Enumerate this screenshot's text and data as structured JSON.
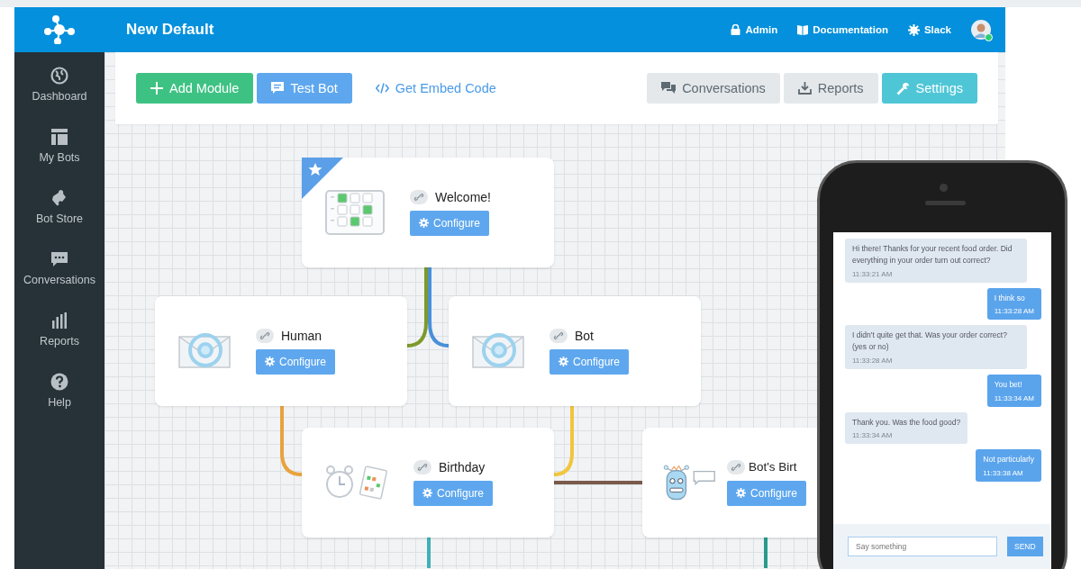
{
  "header": {
    "title": "New Default",
    "links": [
      {
        "label": "Admin"
      },
      {
        "label": "Documentation"
      },
      {
        "label": "Slack"
      }
    ],
    "user": {
      "online": true
    }
  },
  "sidebar": {
    "items": [
      {
        "label": "Dashboard"
      },
      {
        "label": "My Bots"
      },
      {
        "label": "Bot Store"
      },
      {
        "label": "Conversations"
      },
      {
        "label": "Reports"
      },
      {
        "label": "Help"
      }
    ]
  },
  "toolbar": {
    "left": [
      {
        "label": "Add Module"
      },
      {
        "label": "Test Bot"
      },
      {
        "label": "Get Embed Code"
      }
    ],
    "right": [
      {
        "label": "Conversations"
      },
      {
        "label": "Reports"
      },
      {
        "label": "Settings"
      }
    ]
  },
  "modules": [
    {
      "title": "Welcome!",
      "kind": "checklist",
      "starred": true,
      "button": "Configure"
    },
    {
      "title": "Human",
      "kind": "email",
      "starred": false,
      "button": "Configure"
    },
    {
      "title": "Bot",
      "kind": "email",
      "starred": false,
      "button": "Configure"
    },
    {
      "title": "Birthday",
      "kind": "schedule",
      "starred": false,
      "button": "Configure"
    },
    {
      "title": "Bot's Birt",
      "kind": "robot",
      "starred": false,
      "button": "Configure"
    }
  ],
  "connectors": [
    {
      "color": "#7c9a2b"
    },
    {
      "color": "#4a90d9"
    },
    {
      "color": "#e8a33d"
    },
    {
      "color": "#f2c53d"
    },
    {
      "color": "#7a5a4a"
    },
    {
      "color": "#3fb0b8"
    },
    {
      "color": "#2a9a8a"
    }
  ],
  "chat": {
    "messages": [
      {
        "kind": "bot",
        "text": "Hi there! Thanks for your recent food order. Did everything in your order turn out correct?",
        "time": "11:33:21 AM"
      },
      {
        "kind": "user",
        "text": "I think so",
        "time": "11:33:28 AM"
      },
      {
        "kind": "bot",
        "text": "I didn't quite get that. Was your order correct? (yes or no)",
        "time": "11:33:28 AM"
      },
      {
        "kind": "user",
        "text": "You bet!",
        "time": "11:33:34 AM"
      },
      {
        "kind": "bot",
        "text": "Thank you. Was the food good?",
        "time": "11:33:34 AM"
      },
      {
        "kind": "user",
        "text": "Not particularly",
        "time": "11:33:38 AM"
      }
    ],
    "input": {
      "placeholder": "Say something"
    },
    "send": "SEND"
  }
}
